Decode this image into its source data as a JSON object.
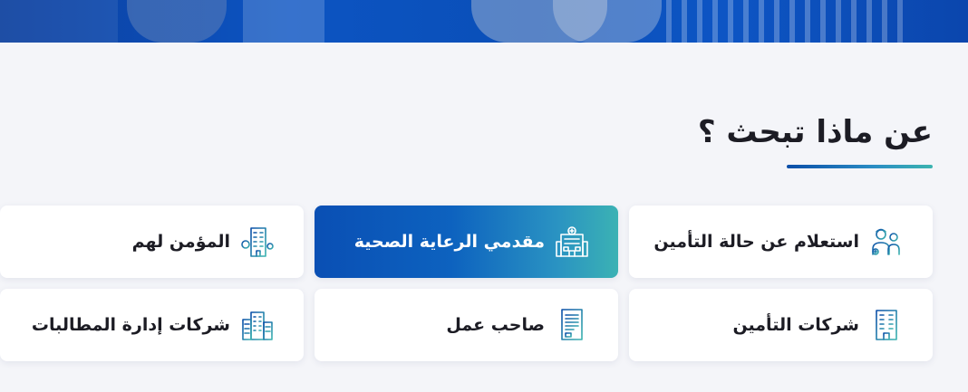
{
  "hero": {
    "image": "people-banner"
  },
  "section": {
    "title": "عن ماذا تبحث ؟"
  },
  "cards": [
    {
      "label": "استعلام عن حالة التأمين",
      "icon": "doctor-patient-icon",
      "active": false
    },
    {
      "label": "مقدمي الرعاية الصحية",
      "icon": "hospital-icon",
      "active": true
    },
    {
      "label": "المؤمن لهم",
      "icon": "building-tree-icon",
      "active": false
    },
    {
      "label": "شركات التأمين",
      "icon": "office-building-icon",
      "active": false
    },
    {
      "label": "صاحب عمل",
      "icon": "document-icon",
      "active": false
    },
    {
      "label": "شركات إدارة المطالبات",
      "icon": "city-buildings-icon",
      "active": false
    }
  ],
  "colors": {
    "accent": "#0a4fb4",
    "accent_end": "#3bb2b4",
    "background": "#f4f5f9",
    "text": "#1c1c24"
  }
}
